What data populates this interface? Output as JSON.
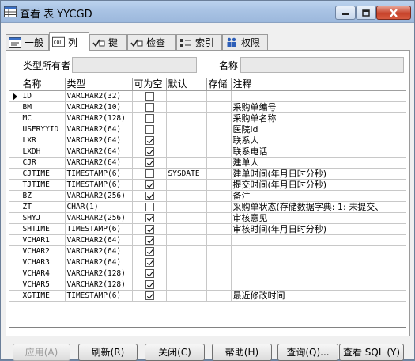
{
  "window": {
    "title": "查看 表 YYCGD"
  },
  "tabs": [
    {
      "label": "一般",
      "icon": "general-icon"
    },
    {
      "label": "列",
      "icon": "columns-icon"
    },
    {
      "label": "键",
      "icon": "key-icon"
    },
    {
      "label": "检查",
      "icon": "check-icon"
    },
    {
      "label": "索引",
      "icon": "index-icon"
    },
    {
      "label": "权限",
      "icon": "privileges-icon"
    }
  ],
  "fields": {
    "type_owner_label": "类型所有者",
    "type_owner_value": "",
    "name_label": "名称",
    "name_value": ""
  },
  "grid": {
    "headers": [
      "名称",
      "类型",
      "可为空",
      "默认",
      "存储",
      "注释"
    ],
    "rows": [
      {
        "name": "ID",
        "type": "VARCHAR2(32)",
        "nullable": false,
        "default": "",
        "storage": "",
        "comment": ""
      },
      {
        "name": "BM",
        "type": "VARCHAR2(10)",
        "nullable": false,
        "default": "",
        "storage": "",
        "comment": "采购单编号"
      },
      {
        "name": "MC",
        "type": "VARCHAR2(128)",
        "nullable": false,
        "default": "",
        "storage": "",
        "comment": "采购单名称"
      },
      {
        "name": "USERYYID",
        "type": "VARCHAR2(64)",
        "nullable": false,
        "default": "",
        "storage": "",
        "comment": "医院id"
      },
      {
        "name": "LXR",
        "type": "VARCHAR2(64)",
        "nullable": true,
        "default": "",
        "storage": "",
        "comment": "联系人"
      },
      {
        "name": "LXDH",
        "type": "VARCHAR2(64)",
        "nullable": true,
        "default": "",
        "storage": "",
        "comment": "联系电话"
      },
      {
        "name": "CJR",
        "type": "VARCHAR2(64)",
        "nullable": true,
        "default": "",
        "storage": "",
        "comment": "建单人"
      },
      {
        "name": "CJTIME",
        "type": "TIMESTAMP(6)",
        "nullable": false,
        "default": "SYSDATE",
        "storage": "",
        "comment": "建单时间(年月日时分秒)"
      },
      {
        "name": "TJTIME",
        "type": "TIMESTAMP(6)",
        "nullable": true,
        "default": "",
        "storage": "",
        "comment": "提交时间(年月日时分秒)"
      },
      {
        "name": "BZ",
        "type": "VARCHAR2(256)",
        "nullable": true,
        "default": "",
        "storage": "",
        "comment": "备注"
      },
      {
        "name": "ZT",
        "type": "CHAR(1)",
        "nullable": false,
        "default": "",
        "storage": "",
        "comment": "采购单状态(存储数据字典: 1: 未提交、"
      },
      {
        "name": "SHYJ",
        "type": "VARCHAR2(256)",
        "nullable": true,
        "default": "",
        "storage": "",
        "comment": "审核意见"
      },
      {
        "name": "SHTIME",
        "type": "TIMESTAMP(6)",
        "nullable": true,
        "default": "",
        "storage": "",
        "comment": "审核时间(年月日时分秒)"
      },
      {
        "name": "VCHAR1",
        "type": "VARCHAR2(64)",
        "nullable": true,
        "default": "",
        "storage": "",
        "comment": ""
      },
      {
        "name": "VCHAR2",
        "type": "VARCHAR2(64)",
        "nullable": true,
        "default": "",
        "storage": "",
        "comment": ""
      },
      {
        "name": "VCHAR3",
        "type": "VARCHAR2(64)",
        "nullable": true,
        "default": "",
        "storage": "",
        "comment": ""
      },
      {
        "name": "VCHAR4",
        "type": "VARCHAR2(128)",
        "nullable": true,
        "default": "",
        "storage": "",
        "comment": ""
      },
      {
        "name": "VCHAR5",
        "type": "VARCHAR2(128)",
        "nullable": true,
        "default": "",
        "storage": "",
        "comment": ""
      },
      {
        "name": "XGTIME",
        "type": "TIMESTAMP(6)",
        "nullable": true,
        "default": "",
        "storage": "",
        "comment": "最近修改时间"
      }
    ],
    "empty_rows": 3
  },
  "buttons": {
    "apply": "应用(A)",
    "refresh": "刷新(R)",
    "close": "关闭(C)",
    "help": "帮助(H)",
    "query": "查询(Q)...",
    "view_sql": "查看 SQL (Y)"
  }
}
